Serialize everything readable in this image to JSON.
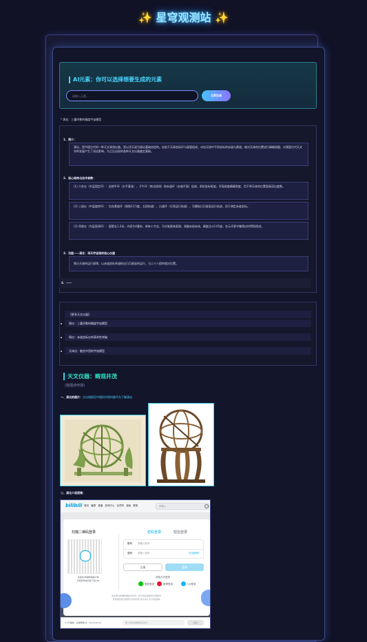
{
  "site": {
    "sparkle": "✨",
    "title": "星穹观测站"
  },
  "ai": {
    "title": "AI元素：你可以选择想要生成的元素",
    "placeholder": "请输入元素...",
    "button": "立即生成"
  },
  "dev": {
    "label": "* 演化：三重环数的精度宇宙模型",
    "sections": [
      {
        "number": "1.",
        "head": "简介：",
        "items": [
          "演化，是中国古代的一种天文观测仪器，是以浑天说为理论基础创造的。由若干天球坐标环与窥管组成，对应天球中不同坐标的赤道与黄道，能对天体的位置进行精确测量，对我国古代天文学的发展产生了深远影响，为之后出现的各种天文仪器奠定基础。"
        ]
      },
      {
        "number": "2.",
        "head": "核心结构与技术参数：",
        "items": [
          "(1) 六合仪（外层固定环）：由地平环（水平基准）、子午环（南北经线）和赤道环（赤道平面）组成，承担坐标框架，环面刻度精确到度，用于将天体的位置直接读出度数。",
          "(2) 三辰仪（中层旋转环）：包含黄道环（倾角23.5度，太阳轨道）、白道环（月亮运行轨道），可模拟日月星辰运行轨迹，用于测定赤道坐标。",
          "(3) 四游仪（内层观测环）：窥管长1.2米，内径为4厘米，带有十字丝，可对准星体观测，测量赤经赤纬，精度达±0.05度，在元代郭守敬简仪时得到改进。"
        ]
      },
      {
        "number": "3.",
        "head": "功能——演化：浑天宇宙观的核心仪器",
        "items": [
          "揭示天球的运行规律，以赤道坐标系描绘出日月星辰的运行，与二十八宿的相对位置。"
        ]
      },
      {
        "number": "4.",
        "head": "——",
        "items": []
      }
    ]
  },
  "more": {
    "title": "【更多天文仪器】",
    "items": [
      "简仪：三重环数的精度宇宙模型",
      "简仪：赤道坐标仪的革命性突破",
      "天体仪：融合中西的宇宙模型"
    ]
  },
  "instruments": {
    "title": "天文仪器：畴观井茂",
    "subtitle": "(鼓捶诗传报)",
    "q1_label": "一、演化的图片：",
    "q1_link": "点击相册至中国科学院科普平台了解演化",
    "q2_label": "二、演化介绍视频："
  },
  "bili": {
    "logo": "bilibili",
    "nav": [
      "首页",
      "番剧",
      "直播",
      "游戏中心",
      "会员购",
      "漫画",
      "赛事"
    ],
    "search_placeholder": "请输入",
    "qr_title": "扫描二维码登录",
    "qr_hint_1": "请使用 哔哩哔哩客户端",
    "qr_hint_2": "扫码登录或扫码下载APP",
    "tab_password": "密码登录",
    "tab_sms": "短信登录",
    "account_label": "账号",
    "account_placeholder": "请输入账号",
    "password_label": "密码",
    "password_placeholder": "请输入密码",
    "forgot": "忘记密码？",
    "register": "注册",
    "login": "登录",
    "other_login": "其他方式登录",
    "wechat": "微信登录",
    "weibo": "微博登录",
    "qq": "QQ登录",
    "notice_1": "未注册过哔哩哔哩的手机号，我们将自动帮你注册账号",
    "notice_2": "登录或完成注册即代表你同意 用户协议 和 隐私政策",
    "footer_user": "2.7万播放 · 总弹幕数29 · 2023-09-26",
    "footer_danmaku_placeholder": "发个友善的弹幕见证当下",
    "footer_send": "发送"
  }
}
